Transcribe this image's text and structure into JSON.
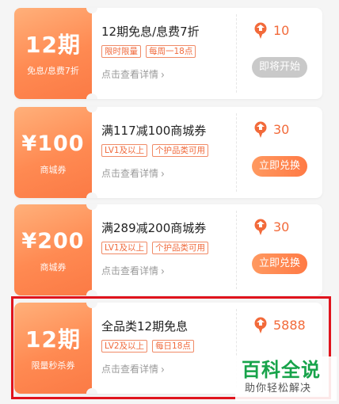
{
  "coupons": [
    {
      "left_main": "12期",
      "left_sub": "免息/息费7折",
      "title": "12期免息/息费7折",
      "tags": [
        "限时限量",
        "每周一18点"
      ],
      "detail": "点击查看详情",
      "points": "10",
      "button": "即将开始",
      "button_state": "disabled"
    },
    {
      "left_main": "¥100",
      "left_sub": "商城券",
      "title": "满117减100商城券",
      "tags": [
        "LV1及以上",
        "个护品类可用"
      ],
      "detail": "点击查看详情",
      "points": "30",
      "button": "立即兑换",
      "button_state": "active"
    },
    {
      "left_main": "¥200",
      "left_sub": "商城券",
      "title": "满289减200商城券",
      "tags": [
        "LV1及以上",
        "个护品类可用"
      ],
      "detail": "点击查看详情",
      "points": "30",
      "button": "立即兑换",
      "button_state": "active"
    },
    {
      "left_main": "12期",
      "left_sub": "限量秒杀券",
      "title": "全品类12期免息",
      "tags": [
        "LV2及以上",
        "每日18点"
      ],
      "detail": "点击查看详情",
      "points": "5888",
      "button": "",
      "button_state": "hidden"
    }
  ],
  "icons": {
    "points": "points-badge-icon",
    "chevron": "chevron-right-icon"
  },
  "colors": {
    "accent": "#ff8a52",
    "highlight_border": "#e0141d",
    "disabled": "#c9c9c9",
    "watermark": "#17a34a"
  },
  "watermark": {
    "main": "百科全说",
    "sub": "助你轻松解决"
  }
}
